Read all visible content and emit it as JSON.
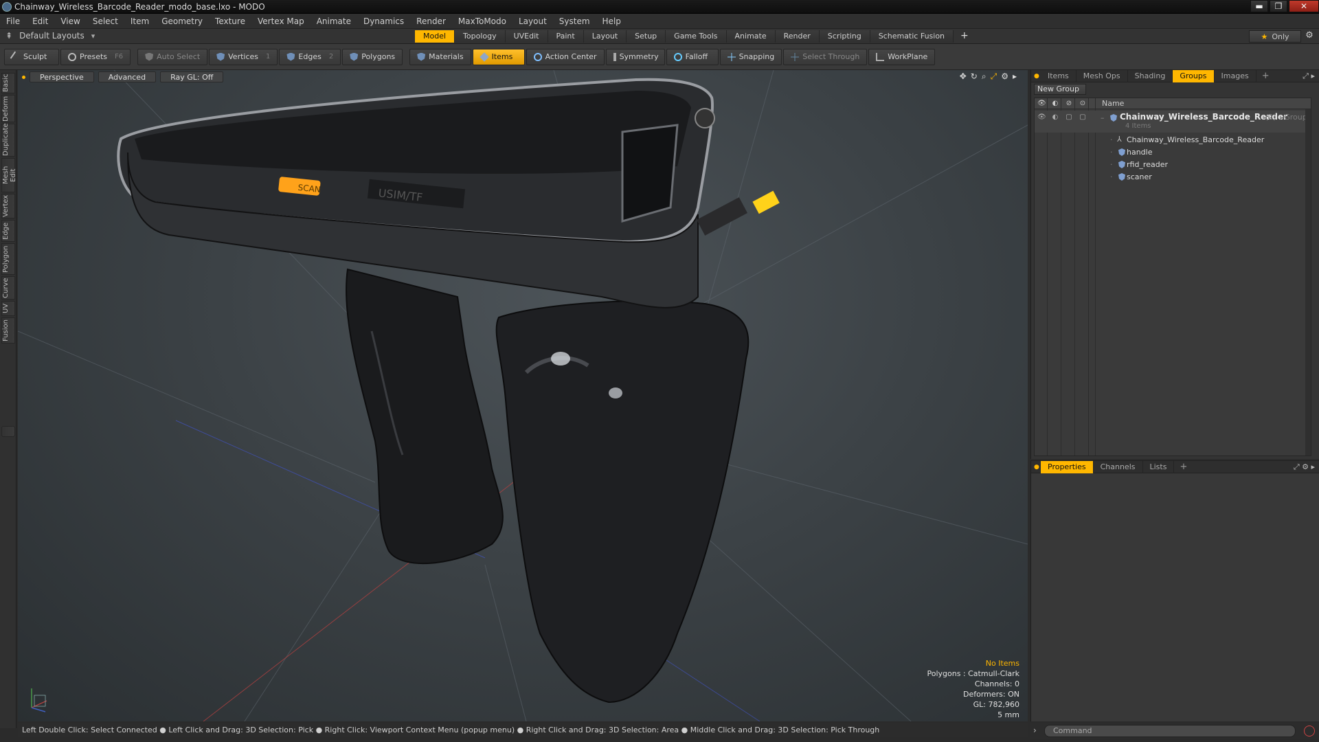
{
  "window": {
    "title": "Chainway_Wireless_Barcode_Reader_modo_base.lxo - MODO",
    "controls": {
      "minimize": "▬",
      "maximize": "❐",
      "close": "✕"
    }
  },
  "menu": [
    "File",
    "Edit",
    "View",
    "Select",
    "Item",
    "Geometry",
    "Texture",
    "Vertex Map",
    "Animate",
    "Dynamics",
    "Render",
    "MaxToModo",
    "Layout",
    "System",
    "Help"
  ],
  "layouts": {
    "label": "Default Layouts",
    "tabs": [
      "Model",
      "Topology",
      "UVEdit",
      "Paint",
      "Layout",
      "Setup",
      "Game Tools",
      "Animate",
      "Render",
      "Scripting",
      "Schematic Fusion"
    ],
    "active_tab": "Model",
    "add": "+",
    "only_label": "Only"
  },
  "toolbar": {
    "sculpt": "Sculpt",
    "presets": "Presets",
    "presets_key": "F6",
    "auto_select": "Auto Select",
    "vertices": "Vertices",
    "vertices_count": "1",
    "edges": "Edges",
    "edges_count": "2",
    "polygons": "Polygons",
    "materials": "Materials",
    "items": "Items",
    "action_center": "Action Center",
    "symmetry": "Symmetry",
    "falloff": "Falloff",
    "snapping": "Snapping",
    "select_through": "Select Through",
    "workplane": "WorkPlane"
  },
  "left_tabs": [
    "Basic",
    "Deform",
    "Duplicate",
    "Mesh Edit",
    "Vertex",
    "Edge",
    "Polygon",
    "Curve",
    "UV",
    "Fusion"
  ],
  "viewport": {
    "view": "Perspective",
    "shading": "Advanced",
    "raygl": "Ray GL: Off",
    "info": {
      "no_items": "No Items",
      "polygons": "Polygons : Catmull-Clark",
      "channels": "Channels: 0",
      "deformers": "Deformers: ON",
      "gl": "GL: 782,960",
      "scale": "5 mm"
    },
    "device_labels": {
      "scan": "SCAN",
      "brand": "USIM/TF"
    }
  },
  "status": "Left Double Click: Select Connected ● Left Click and Drag: 3D Selection: Pick ● Right Click: Viewport Context Menu (popup menu) ● Right Click and Drag: 3D Selection: Area ● Middle Click and Drag: 3D Selection: Pick Through",
  "right_panel": {
    "tabs": [
      "Items",
      "Mesh Ops",
      "Shading",
      "Groups",
      "Images"
    ],
    "active_tab": "Groups",
    "new_group": "New Group",
    "name_header": "Name",
    "group": {
      "name": "Chainway_Wireless_Barcode_Reader",
      "count": "(2)",
      "type": ": Group",
      "subtitle": "4 Items",
      "children": [
        "Chainway_Wireless_Barcode_Reader",
        "handle",
        "rfid_reader",
        "scaner"
      ]
    }
  },
  "properties_panel": {
    "tabs": [
      "Properties",
      "Channels",
      "Lists"
    ],
    "active_tab": "Properties"
  },
  "command": {
    "placeholder": "Command"
  },
  "colors": {
    "accent": "#ffb700",
    "background": "#2b2b2b"
  }
}
